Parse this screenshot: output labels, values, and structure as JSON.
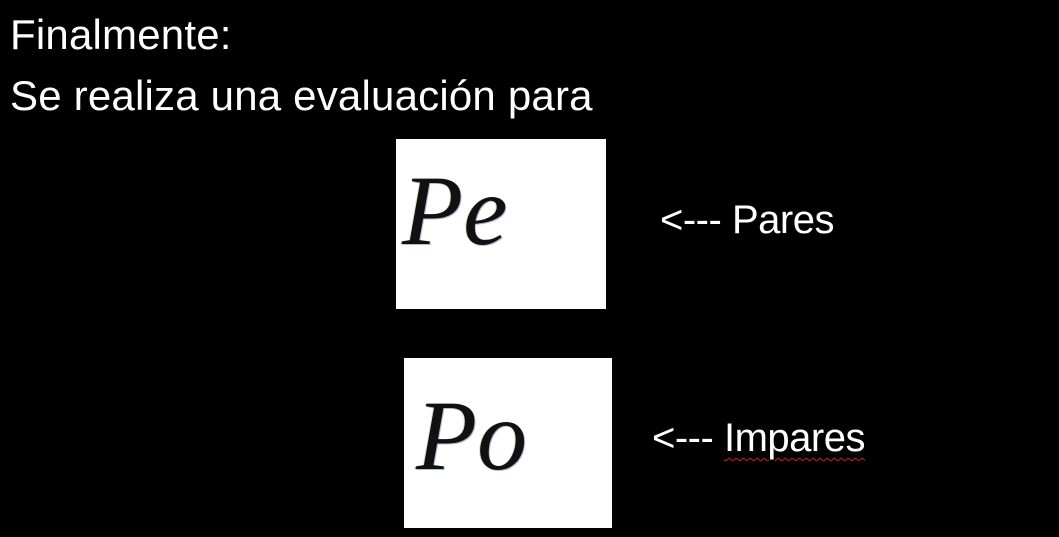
{
  "heading": {
    "line1": "Finalmente:",
    "line2": "Se realiza una evaluación para"
  },
  "formulas": [
    {
      "symbol": "Pe",
      "arrow": "<---",
      "label": "Pares"
    },
    {
      "symbol": "Po",
      "arrow": "<---",
      "label": "Impares",
      "spellcheck_flagged": true
    }
  ],
  "colors": {
    "background": "#000000",
    "text": "#ffffff",
    "formula_box": "#ffffff",
    "spellcheck_underline": "#d02020"
  }
}
